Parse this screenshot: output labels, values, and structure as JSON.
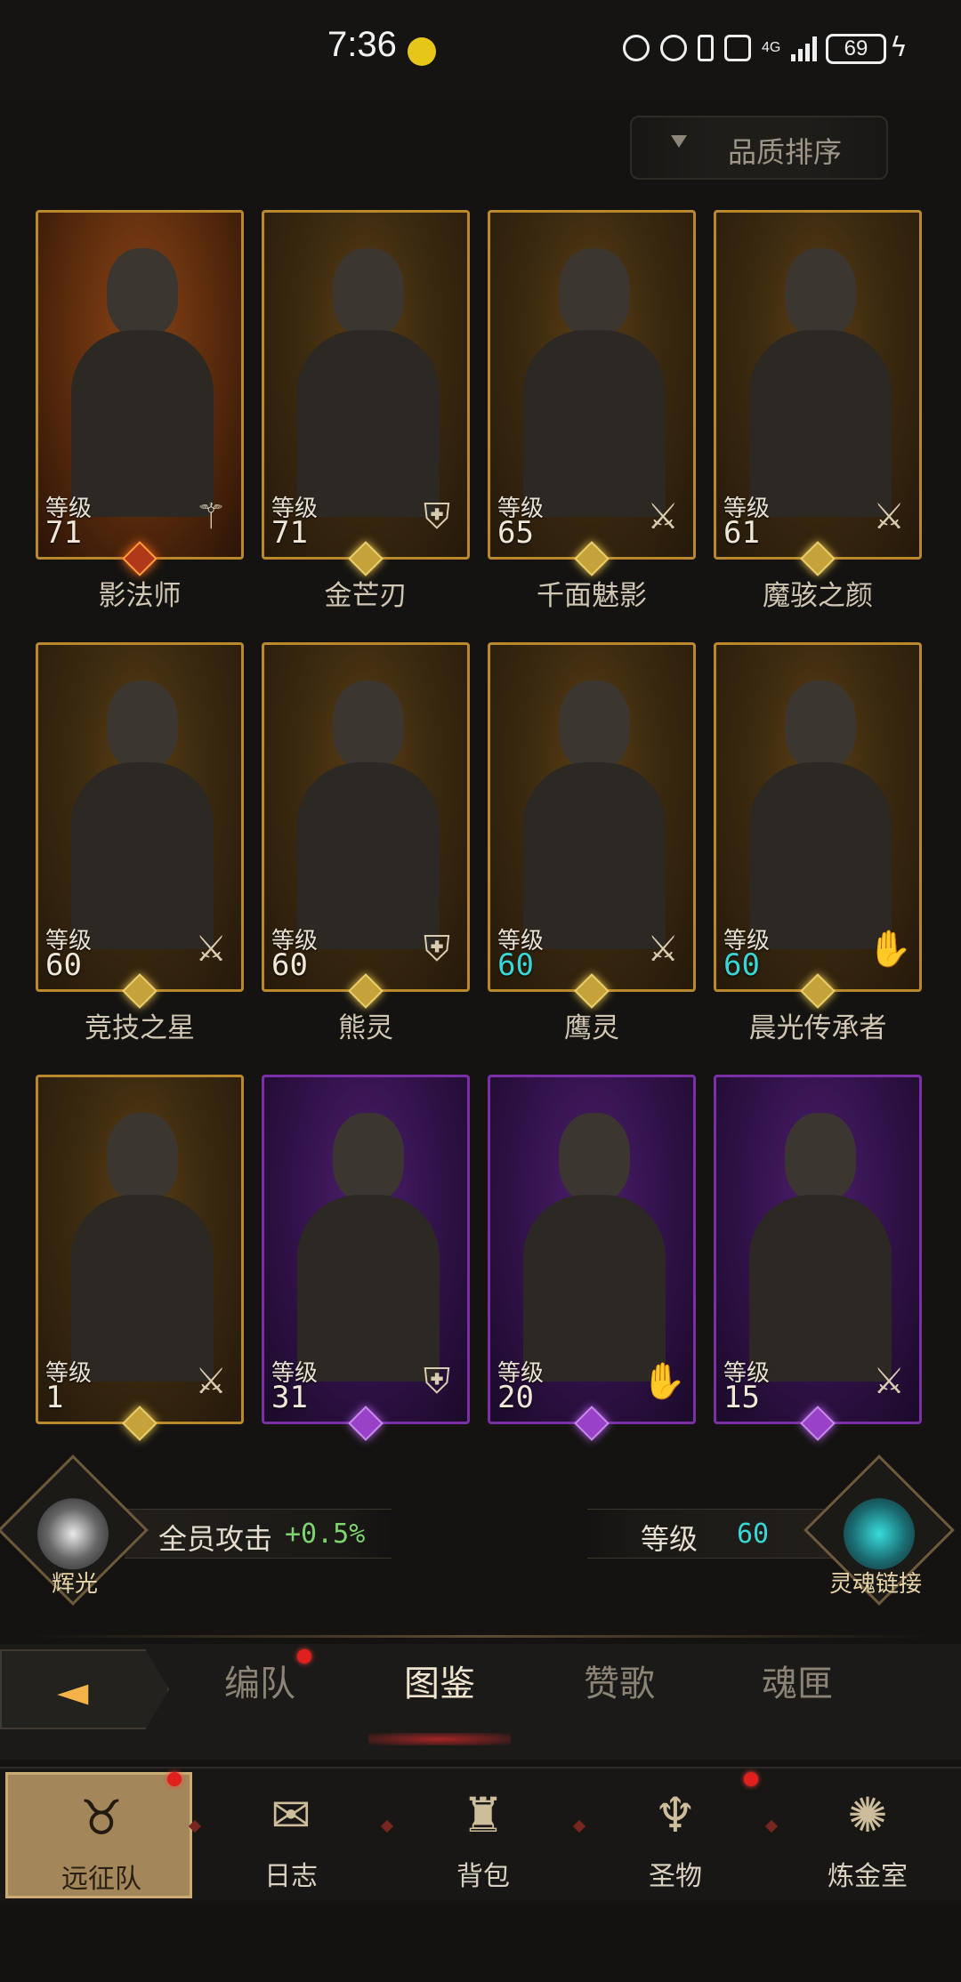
{
  "status_bar": {
    "time": "7:36",
    "network": "4G",
    "battery": "69"
  },
  "sort_button": {
    "label": "品质排序"
  },
  "heroes": [
    {
      "name": "影法师",
      "level_label": "等级",
      "level": "71",
      "frame": "orange",
      "class_icon": "staff-icon",
      "level_color": "white",
      "gem": "star"
    },
    {
      "name": "金芒刃",
      "level_label": "等级",
      "level": "71",
      "frame": "gold",
      "class_icon": "shield-icon",
      "level_color": "white",
      "gem": "gold"
    },
    {
      "name": "千面魅影",
      "level_label": "等级",
      "level": "65",
      "frame": "gold",
      "class_icon": "sword-icon",
      "level_color": "white",
      "gem": "gold"
    },
    {
      "name": "魔骇之颜",
      "level_label": "等级",
      "level": "61",
      "frame": "gold",
      "class_icon": "sword-icon",
      "level_color": "white",
      "gem": "gold"
    },
    {
      "name": "竞技之星",
      "level_label": "等级",
      "level": "60",
      "frame": "gold",
      "class_icon": "sword-icon",
      "level_color": "white",
      "gem": "gold"
    },
    {
      "name": "熊灵",
      "level_label": "等级",
      "level": "60",
      "frame": "gold",
      "class_icon": "shield-icon",
      "level_color": "white",
      "gem": "gold"
    },
    {
      "name": "鹰灵",
      "level_label": "等级",
      "level": "60",
      "frame": "gold",
      "class_icon": "sword-icon",
      "level_color": "cyan",
      "gem": "gold"
    },
    {
      "name": "晨光传承者",
      "level_label": "等级",
      "level": "60",
      "frame": "gold",
      "class_icon": "hand-icon",
      "level_color": "cyan",
      "gem": "gold"
    },
    {
      "name": "",
      "level_label": "等级",
      "level": "1",
      "frame": "gold",
      "class_icon": "sword-icon",
      "level_color": "white",
      "gem": "gold"
    },
    {
      "name": "",
      "level_label": "等级",
      "level": "31",
      "frame": "purple",
      "class_icon": "shield-icon",
      "level_color": "white",
      "gem": "purple"
    },
    {
      "name": "",
      "level_label": "等级",
      "level": "20",
      "frame": "purple",
      "class_icon": "hand-icon",
      "level_color": "white",
      "gem": "purple"
    },
    {
      "name": "",
      "level_label": "等级",
      "level": "15",
      "frame": "purple",
      "class_icon": "sword-icon",
      "level_color": "white",
      "gem": "purple"
    }
  ],
  "bonus": {
    "glow_label": "辉光",
    "attack_label": "全员攻击",
    "attack_value": "+0.5%",
    "level_label": "等级",
    "level_value": "60",
    "soul_link_label": "灵魂链接"
  },
  "tabs": [
    {
      "label": "编队",
      "active": false,
      "badge": true
    },
    {
      "label": "图鉴",
      "active": true,
      "badge": false
    },
    {
      "label": "赞歌",
      "active": false,
      "badge": false
    },
    {
      "label": "魂匣",
      "active": false,
      "badge": false
    }
  ],
  "bottom_nav": [
    {
      "label": "远征队",
      "icon": "horned-helmet-icon",
      "active": true,
      "badge": true
    },
    {
      "label": "日志",
      "icon": "scroll-icon",
      "active": false,
      "badge": false
    },
    {
      "label": "背包",
      "icon": "bag-icon",
      "active": false,
      "badge": false
    },
    {
      "label": "圣物",
      "icon": "chalice-icon",
      "active": false,
      "badge": true
    },
    {
      "label": "炼金室",
      "icon": "alchemy-icon",
      "active": false,
      "badge": false
    }
  ]
}
